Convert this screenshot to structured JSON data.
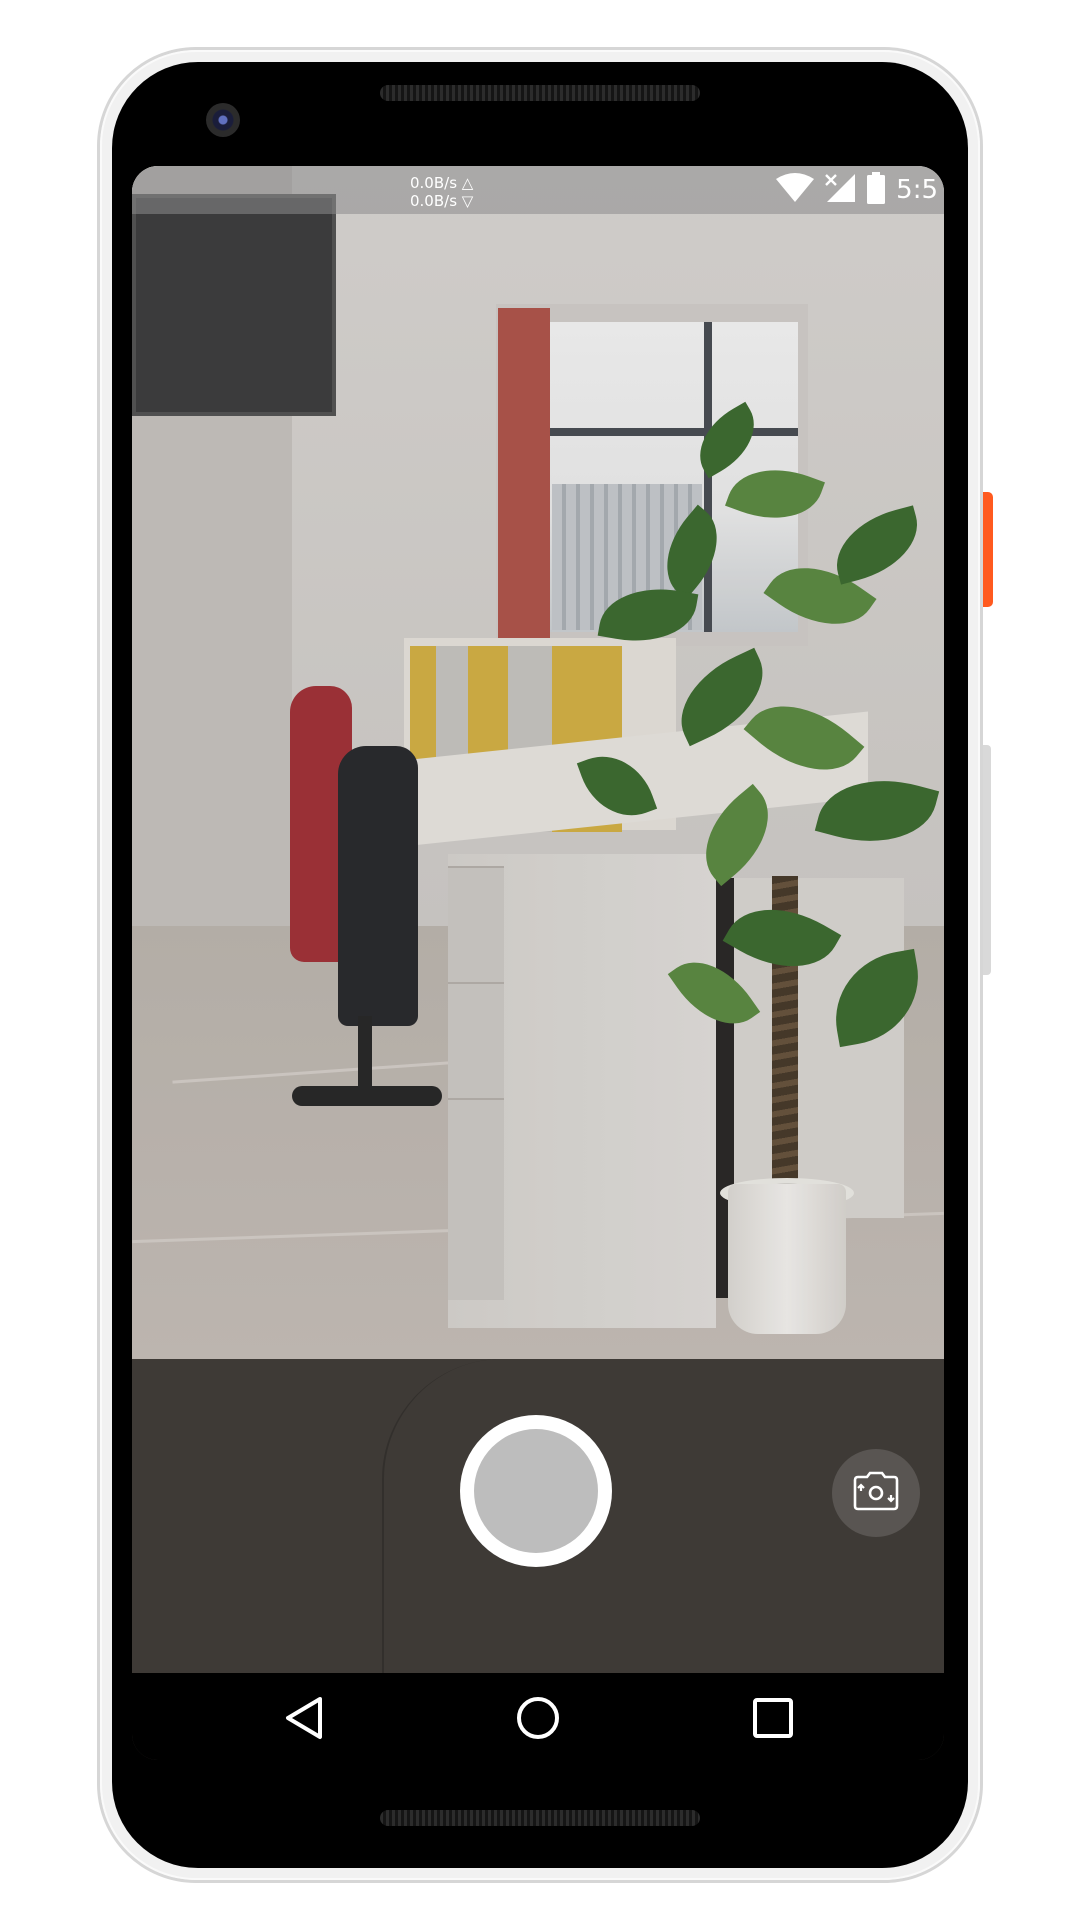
{
  "status_bar": {
    "upload_speed": "0.0B/s △",
    "download_speed": "0.0B/s ▽",
    "time": "5:5",
    "icons": [
      "wifi-icon",
      "cell-signal-no-service-icon",
      "battery-icon"
    ]
  },
  "camera": {
    "controls": [
      "shutter-button",
      "switch-camera-icon"
    ]
  },
  "navigation_bar": {
    "buttons": [
      "back-icon",
      "home-icon",
      "recents-icon"
    ]
  },
  "colors": {
    "controls_background": "#3e3a36",
    "shutter_outer": "#ffffff",
    "shutter_inner": "#bdbdbd",
    "nav_background": "#000000",
    "phone_accent_button": "#ff5a1f"
  }
}
